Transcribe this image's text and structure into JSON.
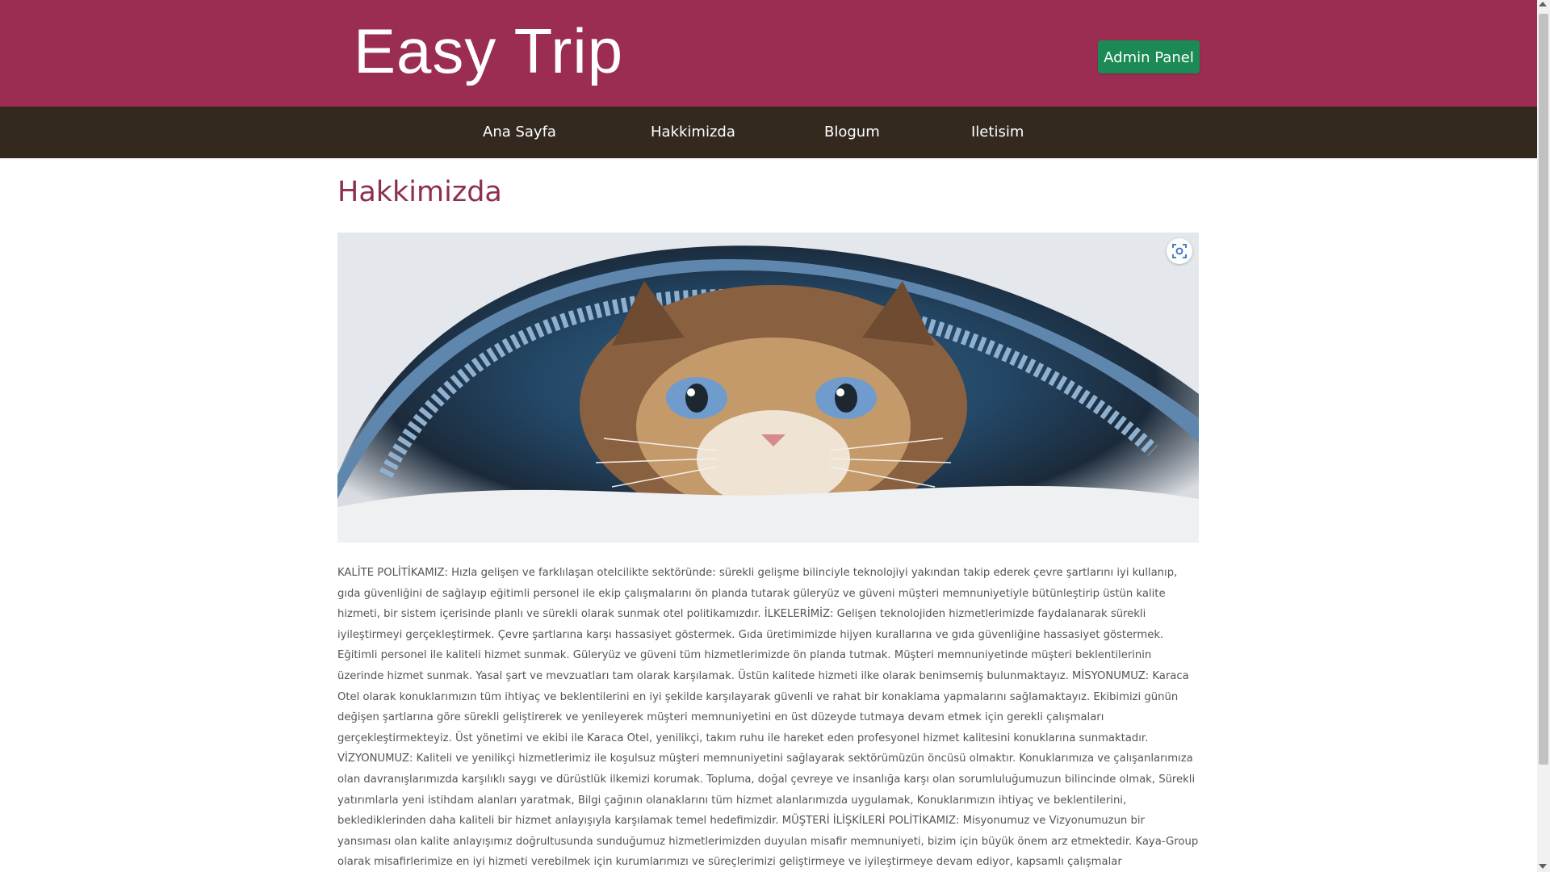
{
  "header": {
    "logo": "Easy Trip",
    "admin_button": "Admin Panel",
    "bg_color": "#9b2d52",
    "admin_color": "#1b8a55"
  },
  "nav": {
    "items": [
      {
        "label": "Ana Sayfa"
      },
      {
        "label": "Hakkimizda"
      },
      {
        "label": "Blogum"
      },
      {
        "label": "Iletisim"
      }
    ],
    "bg_color": "#33291f"
  },
  "main": {
    "title": "Hakkimizda",
    "title_color": "#8f2f50",
    "image_icon": "screen-capture-icon",
    "body": "KALİTE POLİTİKAMIZ: Hızla gelişen ve farklılaşan otelcilikte sektöründe: sürekli gelişme bilinciyle teknolojiyi yakından takip ederek çevre şartlarını iyi kullanıp, gıda güvenliğini de sağlayıp eğitimli personel ile ekip çalışmalarını ön planda tutarak güleryüz ve güveni müşteri memnuniyetiyle bütünleştirip üstün kalite hizmeti, bir sistem içerisinde planlı ve sürekli olarak sunmak otel politikamızdır. İLKELERİMİZ: Gelişen teknolojiden hizmetlerimizde faydalanarak sürekli iyileştirmeyi gerçekleştirmek. Çevre şartlarına karşı hassasiyet göstermek. Gıda üretimimizde hijyen kurallarına ve gıda güvenliğine hassasiyet göstermek. Eğitimli personel ile kaliteli hizmet sunmak. Güleryüz ve güveni tüm hizmetlerimizde ön planda tutmak. Müşteri memnuniyetinde müşteri beklentilerinin üzerinde hizmet sunmak. Yasal şart ve mevzuatları tam olarak karşılamak. Üstün kalitede hizmeti ilke olarak benimsemiş bulunmaktayız. MİSYONUMUZ: Karaca Otel olarak konuklarımızın tüm ihtiyaç ve beklentilerini en iyi şekilde karşılayarak güvenli ve rahat bir konaklama yapmalarını sağlamaktayız. Ekibimizi günün değişen şartlarına göre sürekli geliştirerek ve yenileyerek müşteri memnuniyetini en üst düzeyde tutmaya devam etmek için gerekli çalışmaları gerçekleştirmekteyiz. Üst yönetimi ve ekibi ile Karaca Otel, yenilikçi, takım ruhu ile hareket eden profesyonel hizmet kalitesini konuklarına sunmaktadır. VİZYONUMUZ: Kaliteli ve yenilikçi hizmetlerimiz ile koşulsuz müşteri memnuniyetini sağlayarak sektörümüzün öncüsü olmaktır. Konuklarımıza ve çalışanlarımıza olan davranışlarımızda karşılıklı saygı ve dürüstlük ilkemizi korumak. Topluma, doğal çevreye ve insanlığa karşı olan sorumluluğumuzun bilincinde olmak, Sürekli yatırımlarla yeni istihdam alanları yaratmak, Bilgi çağının olanaklarını tüm hizmet alanlarımızda uygulamak, Konuklarımızın ihtiyaç ve beklentilerini, beklediklerinden daha kaliteli bir hizmet anlayışıyla karşılamak temel hedefimizdir. MÜŞTERİ İLİŞKİLERİ POLİTİKAMIZ: Misyonumuz ve Vizyonumuzun bir yansıması olan kalite anlayışımız doğrultusunda sunduğumuz hizmetlerimizden duyulan misafir memnuniyeti, bizim için büyük önem arz etmektedir. Kaya-Group olarak misafirlerimize en iyi hizmeti verebilmek için kurumlarımızı ve süreçlerimizi geliştirmeye ve iyileştirmeye devam ediyor, kapsamlı çalışmalar gerçekleştiriyoruz. Müşterilerimizin ihtiyaçları doğrultusunda hızlı ve etkin çözümler üretmek, en iyi hizmeti verebilmek ve beklentilerini en üst düzeyde karşılayabilmek için, Tüm Kaya-Group"
  }
}
